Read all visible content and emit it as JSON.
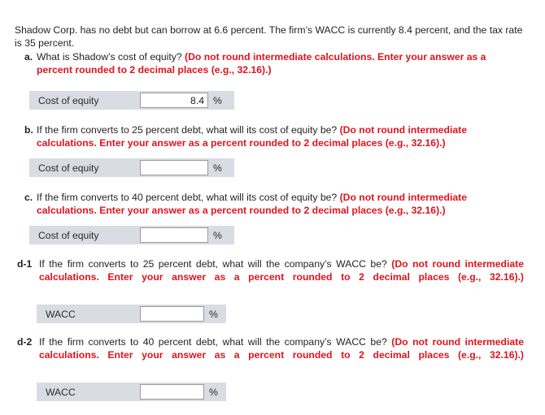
{
  "intro": {
    "text": "Shadow Corp. has no debt but can borrow at 6.6 percent. The firm’s WACC is currently 8.4 percent, and the tax rate is 35 percent."
  },
  "questions": [
    {
      "marker": "a.",
      "question": "What is Shadow’s cost of equity? ",
      "instruction": "(Do not round intermediate calculations. Enter your answer as a percent rounded to 2 decimal places (e.g., 32.16).)",
      "answer": {
        "label": "Cost of equity",
        "value": "8.4",
        "placeholder": "",
        "unit": "%"
      }
    },
    {
      "marker": "b.",
      "question": "If the firm converts to 25 percent debt, what will its cost of equity be? ",
      "instruction": "(Do not round intermediate calculations. Enter your answer as a percent rounded to 2 decimal places (e.g., 32.16).)",
      "answer": {
        "label": "Cost of equity",
        "value": "",
        "placeholder": "",
        "unit": "%"
      }
    },
    {
      "marker": "c.",
      "question": "If the firm converts to 40 percent debt, what will its cost of equity be? ",
      "instruction": "(Do not round intermediate calculations. Enter your answer as a percent rounded to 2 decimal places (e.g., 32.16).)",
      "answer": {
        "label": "Cost of equity",
        "value": "",
        "placeholder": "",
        "unit": "%"
      }
    },
    {
      "marker": "d-1",
      "question": "If the firm converts to 25 percent debt, what will the company’s WACC be? ",
      "instruction": "(Do not round intermediate calculations. Enter your answer as a percent rounded to 2 decimal places (e.g., 32.16).)",
      "answer": {
        "label": "WACC",
        "value": "",
        "placeholder": "",
        "unit": "%"
      }
    },
    {
      "marker": "d-2",
      "question": "If the firm converts to 40 percent debt, what will the company’s WACC be? ",
      "instruction": "(Do not round intermediate calculations. Enter your answer as a percent rounded to 2 decimal places (e.g., 32.16).)",
      "answer": {
        "label": "WACC",
        "value": "",
        "placeholder": "",
        "unit": "%"
      }
    }
  ],
  "colors": {
    "instruction_red": "#e0141e",
    "label_cell_gray": "#d9dce3",
    "input_border": "#9a9a9a",
    "body_text": "#231f20",
    "page_background": "#ffffff"
  }
}
